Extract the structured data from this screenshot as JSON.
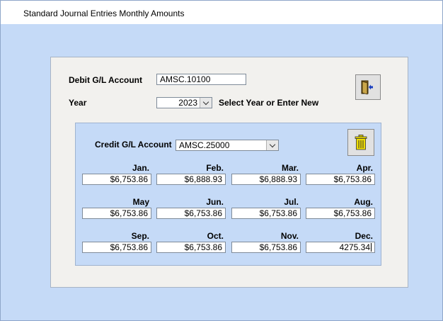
{
  "window": {
    "title": "Standard Journal Entries Monthly Amounts"
  },
  "form": {
    "debit_label": "Debit G/L Account",
    "debit_value": "AMSC.10100",
    "year_label": "Year",
    "year_value": "2023",
    "year_hint": "Select Year or Enter New",
    "exit_icon": "exit-door-icon"
  },
  "credit": {
    "label": "Credit G/L Account",
    "value": "AMSC.25000",
    "delete_icon": "trash-icon",
    "months": [
      {
        "label": "Jan.",
        "value": "$6,753.86"
      },
      {
        "label": "Feb.",
        "value": "$6,888.93"
      },
      {
        "label": "Mar.",
        "value": "$6,888.93"
      },
      {
        "label": "Apr.",
        "value": "$6,753.86"
      },
      {
        "label": "May",
        "value": "$6,753.86"
      },
      {
        "label": "Jun.",
        "value": "$6,753.86"
      },
      {
        "label": "Jul.",
        "value": "$6,753.86"
      },
      {
        "label": "Aug.",
        "value": "$6,753.86"
      },
      {
        "label": "Sep.",
        "value": "$6,753.86"
      },
      {
        "label": "Oct.",
        "value": "$6,753.86"
      },
      {
        "label": "Nov.",
        "value": "$6,753.86"
      },
      {
        "label": "Dec.",
        "value": "4275.34"
      }
    ]
  },
  "colors": {
    "background": "#c5daf7",
    "panel": "#f2f1ee"
  }
}
